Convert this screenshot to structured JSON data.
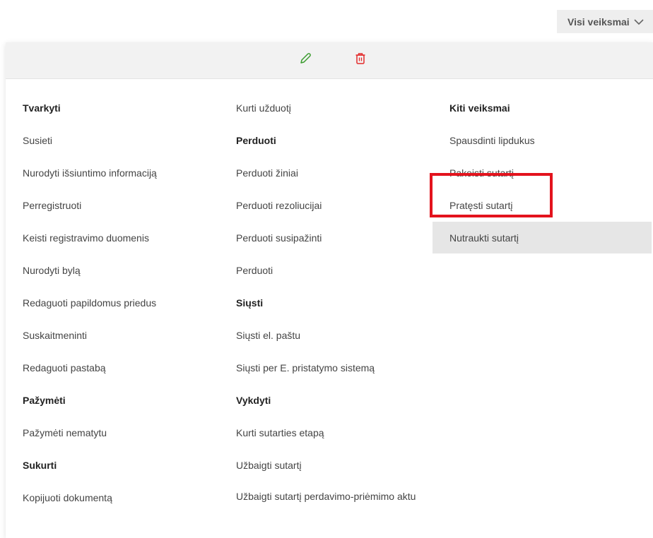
{
  "header": {
    "all_actions_label": "Visi veiksmai",
    "chevron_icon": "chevron-down-icon"
  },
  "toolbar": {
    "edit_icon": "pencil-icon",
    "delete_icon": "trash-icon",
    "edit_color": "#3a9b2e",
    "delete_color": "#e32b2b"
  },
  "columns": [
    {
      "items": [
        {
          "label": "Tvarkyti",
          "type": "heading"
        },
        {
          "label": "Susieti",
          "type": "action"
        },
        {
          "label": "Nurodyti išsiuntimo informaciją",
          "type": "action"
        },
        {
          "label": "Perregistruoti",
          "type": "action"
        },
        {
          "label": "Keisti registravimo duomenis",
          "type": "action"
        },
        {
          "label": "Nurodyti bylą",
          "type": "action"
        },
        {
          "label": "Redaguoti papildomus priedus",
          "type": "action"
        },
        {
          "label": "Suskaitmeninti",
          "type": "action"
        },
        {
          "label": "Redaguoti pastabą",
          "type": "action"
        },
        {
          "label": "Pažymėti",
          "type": "heading"
        },
        {
          "label": "Pažymėti nematytu",
          "type": "action"
        },
        {
          "label": "Sukurti",
          "type": "heading"
        },
        {
          "label": "Kopijuoti dokumentą",
          "type": "action"
        }
      ]
    },
    {
      "items": [
        {
          "label": "Kurti užduotį",
          "type": "action"
        },
        {
          "label": "Perduoti",
          "type": "heading"
        },
        {
          "label": "Perduoti žiniai",
          "type": "action"
        },
        {
          "label": "Perduoti rezoliucijai",
          "type": "action"
        },
        {
          "label": "Perduoti susipažinti",
          "type": "action"
        },
        {
          "label": "Perduoti",
          "type": "action"
        },
        {
          "label": "Siųsti",
          "type": "heading"
        },
        {
          "label": "Siųsti el. paštu",
          "type": "action"
        },
        {
          "label": "Siųsti per E. pristatymo sistemą",
          "type": "action"
        },
        {
          "label": "Vykdyti",
          "type": "heading"
        },
        {
          "label": "Kurti sutarties etapą",
          "type": "action"
        },
        {
          "label": "Užbaigti sutartį",
          "type": "action"
        },
        {
          "label": "Užbaigti sutartį perdavimo-priėmimo aktu",
          "type": "action"
        }
      ]
    },
    {
      "items": [
        {
          "label": "Kiti veiksmai",
          "type": "heading"
        },
        {
          "label": "Spausdinti lipdukus",
          "type": "action"
        },
        {
          "label": "Pakeisti sutartį",
          "type": "action"
        },
        {
          "label": "Pratęsti sutartį",
          "type": "action"
        },
        {
          "label": "Nutraukti sutartį",
          "type": "action",
          "selected": true
        }
      ]
    }
  ],
  "highlight_color": "#e3131d"
}
